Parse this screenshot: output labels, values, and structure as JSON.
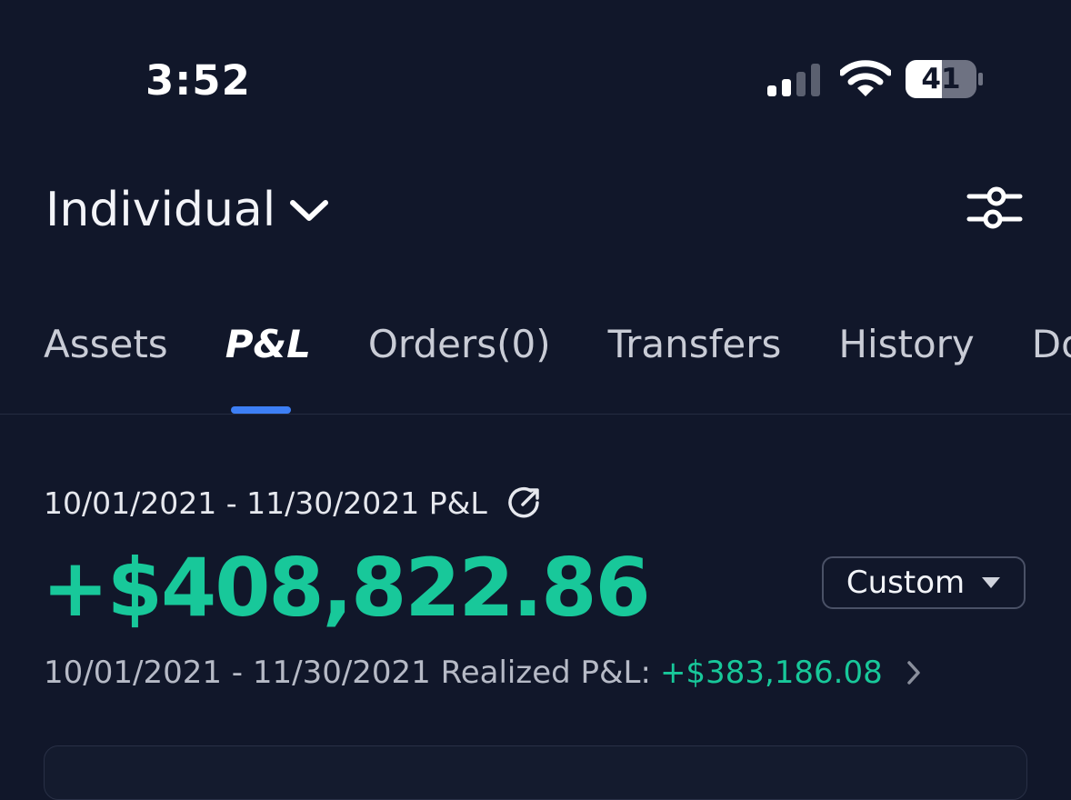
{
  "status_bar": {
    "time": "3:52",
    "battery": "41",
    "icons": [
      "signal-icon",
      "wifi-icon",
      "battery-icon"
    ]
  },
  "header": {
    "account": "Individual",
    "icons": [
      "chevron-down-icon",
      "settings-sliders-icon"
    ]
  },
  "tabs": [
    {
      "label": "Assets"
    },
    {
      "label": "P&L",
      "active": true
    },
    {
      "label": "Orders(0)"
    },
    {
      "label": "Transfers"
    },
    {
      "label": "History"
    },
    {
      "label": "Do"
    }
  ],
  "pnl": {
    "range_label": "10/01/2021 - 11/30/2021 P&L",
    "value": "+$408,822.86",
    "period_selector": "Custom",
    "realized_label": "10/01/2021 - 11/30/2021 Realized P&L:",
    "realized_value": "+$383,186.08"
  },
  "colors": {
    "background": "#11172a",
    "positive": "#18c89a",
    "accent": "#3d7ff5",
    "text": "#ffffff",
    "muted": "#b6bac6"
  }
}
